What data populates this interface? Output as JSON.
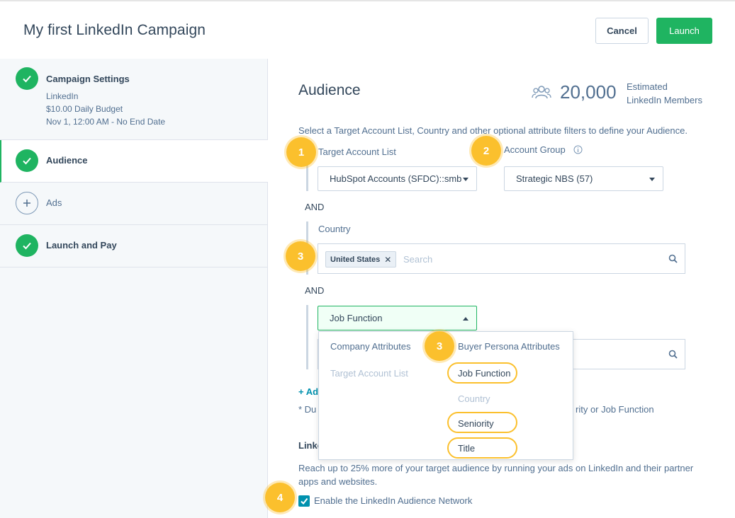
{
  "header": {
    "title": "My first LinkedIn Campaign",
    "cancel_label": "Cancel",
    "launch_label": "Launch"
  },
  "sidebar": {
    "steps": [
      {
        "label": "Campaign Settings",
        "lines": [
          "LinkedIn",
          "$10.00 Daily Budget",
          "Nov 1, 12:00 AM - No End Date"
        ],
        "status": "complete"
      },
      {
        "label": "Audience",
        "status": "complete-active"
      },
      {
        "label": "Ads",
        "status": "incomplete"
      },
      {
        "label": "Launch and Pay",
        "status": "complete"
      }
    ]
  },
  "audience": {
    "title": "Audience",
    "members_count": "20,000",
    "members_label_line1": "Estimated",
    "members_label_line2": "LinkedIn Members",
    "intro": "Select a Target Account List, Country and other optional attribute filters to define your Audience.",
    "target_account_label": "Target Account List",
    "target_account_value": "HubSpot Accounts (SFDC)::smb",
    "account_group_label": "Account Group",
    "account_group_value": "Strategic NBS (57)",
    "and_label": "AND",
    "country_label": "Country",
    "country_chip": "United States",
    "search_placeholder": "Search",
    "attribute_select_value": "Job Function",
    "add_link": "+ Ad",
    "note_left": "* Du",
    "note_right": "rity or Job Function"
  },
  "dropdown": {
    "col1_header": "Company Attributes",
    "col1_items": [
      "Target Account List"
    ],
    "col2_header": "Buyer Persona Attributes",
    "col2_items": [
      "Job Function",
      "Country",
      "Seniority",
      "Title"
    ]
  },
  "network": {
    "title": "Linke",
    "description": "Reach up to 25% more of your target audience by running your ads on LinkedIn and their partner apps and websites.",
    "checkbox_label": "Enable the LinkedIn Audience Network"
  },
  "badges": [
    "1",
    "2",
    "3",
    "3",
    "4"
  ],
  "colors": {
    "accent_green": "#1fb461",
    "badge_yellow": "#fbc02d",
    "link_teal": "#0091ae"
  }
}
